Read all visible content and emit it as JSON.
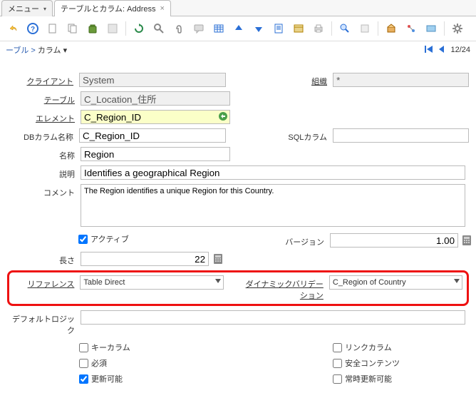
{
  "tabs": {
    "menu": "メニュー",
    "active": "テーブルとカラム: Address"
  },
  "crumbs": {
    "a": "ーブル",
    "sep": " > ",
    "b": "カラム"
  },
  "pager": {
    "pos": "12/24"
  },
  "labels": {
    "client": "クライアント",
    "org": "組織",
    "table": "テーブル",
    "element": "エレメント",
    "dbcol": "DBカラム名称",
    "sqlcol": "SQLカラム",
    "name": "名称",
    "desc": "説明",
    "comment": "コメント",
    "active": "アクティブ",
    "version": "バージョン",
    "length": "長さ",
    "reference": "リファレンス",
    "dynval": "ダイナミックバリデーション",
    "deflogic": "デフォルトロジック",
    "keycol": "キーカラム",
    "linkcol": "リンクカラム",
    "required": "必須",
    "seccontent": "安全コンテンツ",
    "updatable": "更新可能",
    "alwaysupd": "常時更新可能"
  },
  "values": {
    "client": "System",
    "org": "*",
    "table": "C_Location_住所",
    "element": "C_Region_ID",
    "dbcol": "C_Region_ID",
    "sqlcol": "",
    "name": "Region",
    "desc": "Identifies a geographical Region",
    "comment": "The Region identifies a unique Region for this Country.",
    "version": "1.00",
    "length": "22",
    "reference": "Table Direct",
    "dynval": "C_Region of Country",
    "deflogic": ""
  },
  "checks": {
    "active": true,
    "keycol": false,
    "linkcol": false,
    "required": false,
    "seccontent": false,
    "updatable": true,
    "alwaysupd": false
  }
}
